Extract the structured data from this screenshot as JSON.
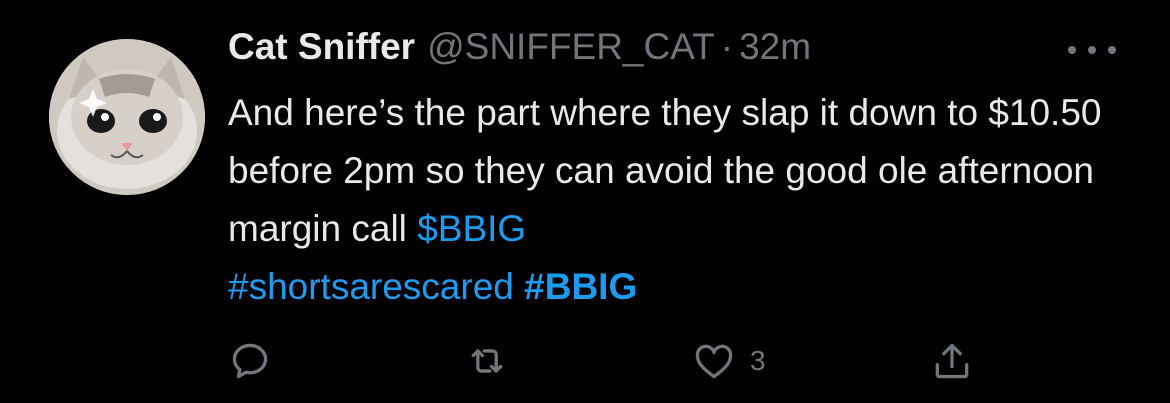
{
  "tweet": {
    "author_name": "Cat Sniffer",
    "handle": "@SNIFFER_CAT",
    "separator": "·",
    "time": "32m",
    "text_plain": "And here’s the part where they slap it down to $10.50 before 2pm so they can avoid the good ole afternoon margin call",
    "cashtag": "$BBIG",
    "hashtag_1": "#shortsarescared",
    "hashtag_2": "#BBIG"
  },
  "actions": {
    "reply_icon": "reply-bubble-icon",
    "retweet_icon": "retweet-icon",
    "like_icon": "heart-icon",
    "like_count": "3",
    "share_icon": "share-upload-icon"
  },
  "colors": {
    "background": "#000000",
    "text": "#e7e9ea",
    "muted": "#71767b",
    "link": "#1d9bf0"
  }
}
